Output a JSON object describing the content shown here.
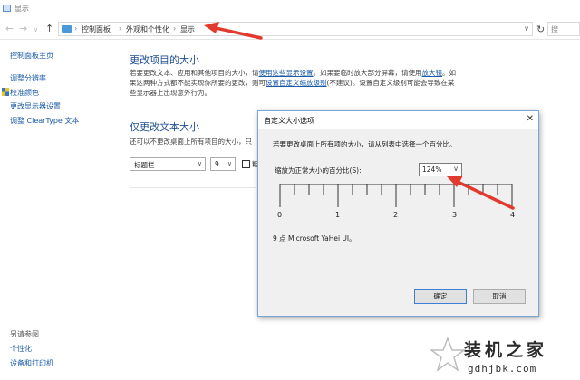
{
  "window": {
    "title": "显示"
  },
  "nav": {
    "back_icon": "back-arrow-icon",
    "forward_icon": "forward-arrow-icon",
    "up_icon": "up-arrow-icon",
    "refresh_icon": "refresh-icon"
  },
  "address": {
    "crumbs": [
      "控制面板",
      "外观和个性化",
      "显示"
    ],
    "search_placeholder": "搜"
  },
  "sidebar": {
    "home": "控制面板主页",
    "items": [
      "调整分辨率",
      "校准颜色",
      "更改显示器设置",
      "调整 ClearType 文本"
    ],
    "see_also_heading": "另请参阅",
    "see_also": [
      "个性化",
      "设备和打印机"
    ]
  },
  "main": {
    "heading": "更改项目的大小",
    "desc_line1_a": "若要更改文本、应用和其他项目的大小，请",
    "desc_link1": "使用这些显示设置",
    "desc_line1_b": "。如果要临时放大部分屏幕，请使用",
    "desc_link2": "放大镜",
    "desc_line1_c": "。如",
    "desc_line2_a": "果这两种方式都不能实现你所要的更改，则可",
    "desc_link3": "设置自定义缩放级别",
    "desc_line2_b": "(不建议)。设置自定义级别可能会导致在某",
    "desc_line3": "些显示器上出现意外行为。",
    "text_only_heading": "仅更改文本大小",
    "text_only_desc": "还可以不更改桌面上所有项目的大小，只",
    "item_select": "标题栏",
    "size_select": "9",
    "bold_label": "粗"
  },
  "dialog": {
    "title": "自定义大小选项",
    "close_icon": "close-icon",
    "instruction": "若要更改桌面上所有项的大小，请从列表中选择一个百分比。",
    "scale_label": "缩放为正常大小的百分比(S):",
    "scale_value": "124%",
    "ruler_labels": [
      "0",
      "1",
      "2",
      "3",
      "4"
    ],
    "font_sample": "9 点 Microsoft YaHei UI。",
    "ok": "确定",
    "cancel": "取消"
  },
  "watermark": {
    "name": "装机之家",
    "url": "gdhjbk.com"
  },
  "colors": {
    "heading": "#1e4f91",
    "link": "#1a5aa8",
    "annotation": "#e23a2e"
  }
}
